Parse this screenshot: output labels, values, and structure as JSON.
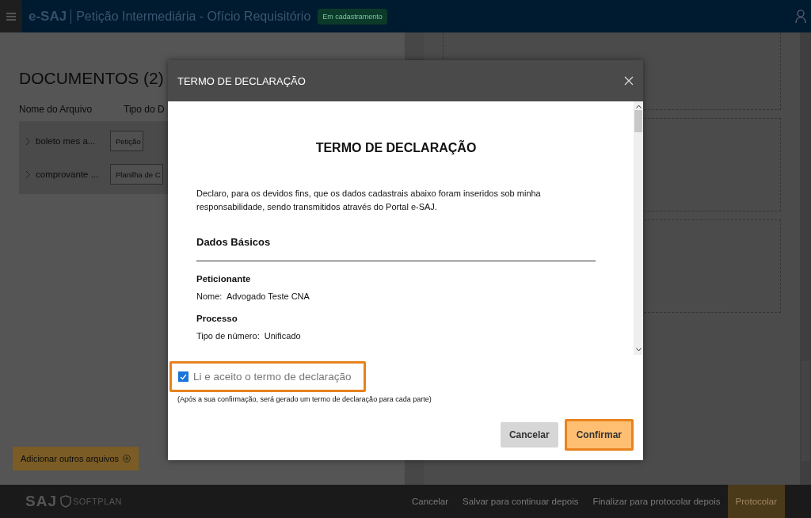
{
  "header": {
    "app_name": "e-SAJ",
    "title": "Petição Intermediária - Ofício Requisitório",
    "status_badge": "Em cadastramento"
  },
  "documents": {
    "title": "DOCUMENTOS (2)",
    "columns": [
      "Nome do Arquivo",
      "Tipo do D"
    ],
    "rows": [
      {
        "name": "boleto mes a...",
        "type": "Petição",
        "expanded": false
      },
      {
        "name": "comprovante ...",
        "type": "Planilha de C",
        "expanded": false
      }
    ],
    "add_button": "Adicionar outros arquivos"
  },
  "dialog": {
    "title": "TERMO DE DECLARAÇÃO",
    "document": {
      "heading": "TERMO DE DECLARAÇÃO",
      "intro": "Declaro, para os devidos fins, que os dados cadastrais abaixo foram inseridos sob minha responsabilidade, sendo transmitidos através do Portal e-SAJ.",
      "section_title": "Dados Básicos",
      "blocks": [
        {
          "label": "Peticionante",
          "fields": [
            "Nome:  Advogado Teste CNA"
          ]
        },
        {
          "label": "Processo",
          "fields": [
            "Tipo de número:  Unificado"
          ]
        }
      ]
    },
    "accept": {
      "label": "Li e aceito o termo de declaração",
      "checked": true
    },
    "note": "(Após a sua confirmação, será gerado um termo de declaração para cada parte)",
    "buttons": [
      {
        "label": "Cancelar",
        "kind": "secondary"
      },
      {
        "label": "Confirmar",
        "kind": "primary"
      }
    ]
  },
  "footer": {
    "logo": "SAJ",
    "brand": "SOFTPLAN",
    "actions": [
      {
        "label": "Cancelar",
        "kind": "link"
      },
      {
        "label": "Salvar para continuar depois",
        "kind": "link"
      },
      {
        "label": "Finalizar para protocolar depois",
        "kind": "link"
      },
      {
        "label": "Protocolar",
        "kind": "primary"
      }
    ]
  }
}
